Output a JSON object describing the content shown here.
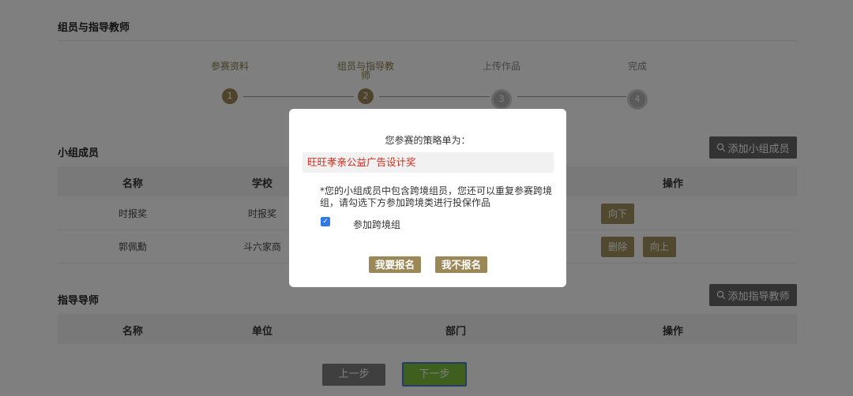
{
  "page": {
    "section_members_title": "组员与指导教师",
    "steps": [
      {
        "label": "参赛资料",
        "num": "1"
      },
      {
        "label": "组员与指导教师",
        "num": "2"
      },
      {
        "label": "上传作品",
        "num": "3"
      },
      {
        "label": "完成",
        "num": "4"
      }
    ],
    "members": {
      "title": "小组成员",
      "add_label": "添加小组成员",
      "headers": [
        "名称",
        "学校",
        "操作"
      ],
      "rows": [
        {
          "name": "时报奖",
          "school": "时报奖",
          "ops": [
            "向下"
          ]
        },
        {
          "name": "郭佩勳",
          "school": "斗六家商",
          "ops": [
            "删除",
            "向上"
          ]
        }
      ]
    },
    "teachers": {
      "title": "指导导师",
      "add_label": "添加指导教师",
      "headers": [
        "名称",
        "单位",
        "部门",
        "操作"
      ]
    },
    "nav": {
      "prev": "上一步",
      "next": "下一步"
    }
  },
  "modal": {
    "title": "您参赛的策略单为：",
    "strategy": "旺旺孝亲公益广告设计奖",
    "note": "*您的小组成员中包含跨境组员，您还可以重复参赛跨境组，请勾选下方参加跨境类进行投保作品",
    "checkbox_label": "参加跨境组",
    "checkbox_checked": true,
    "confirm": "我要报名",
    "decline": "我不报名"
  },
  "colors": {
    "accent": "#9c8856",
    "strategy_text": "#d52b1e",
    "next_button": "#7dbf3a",
    "prev_button": "#7f7f7f"
  }
}
